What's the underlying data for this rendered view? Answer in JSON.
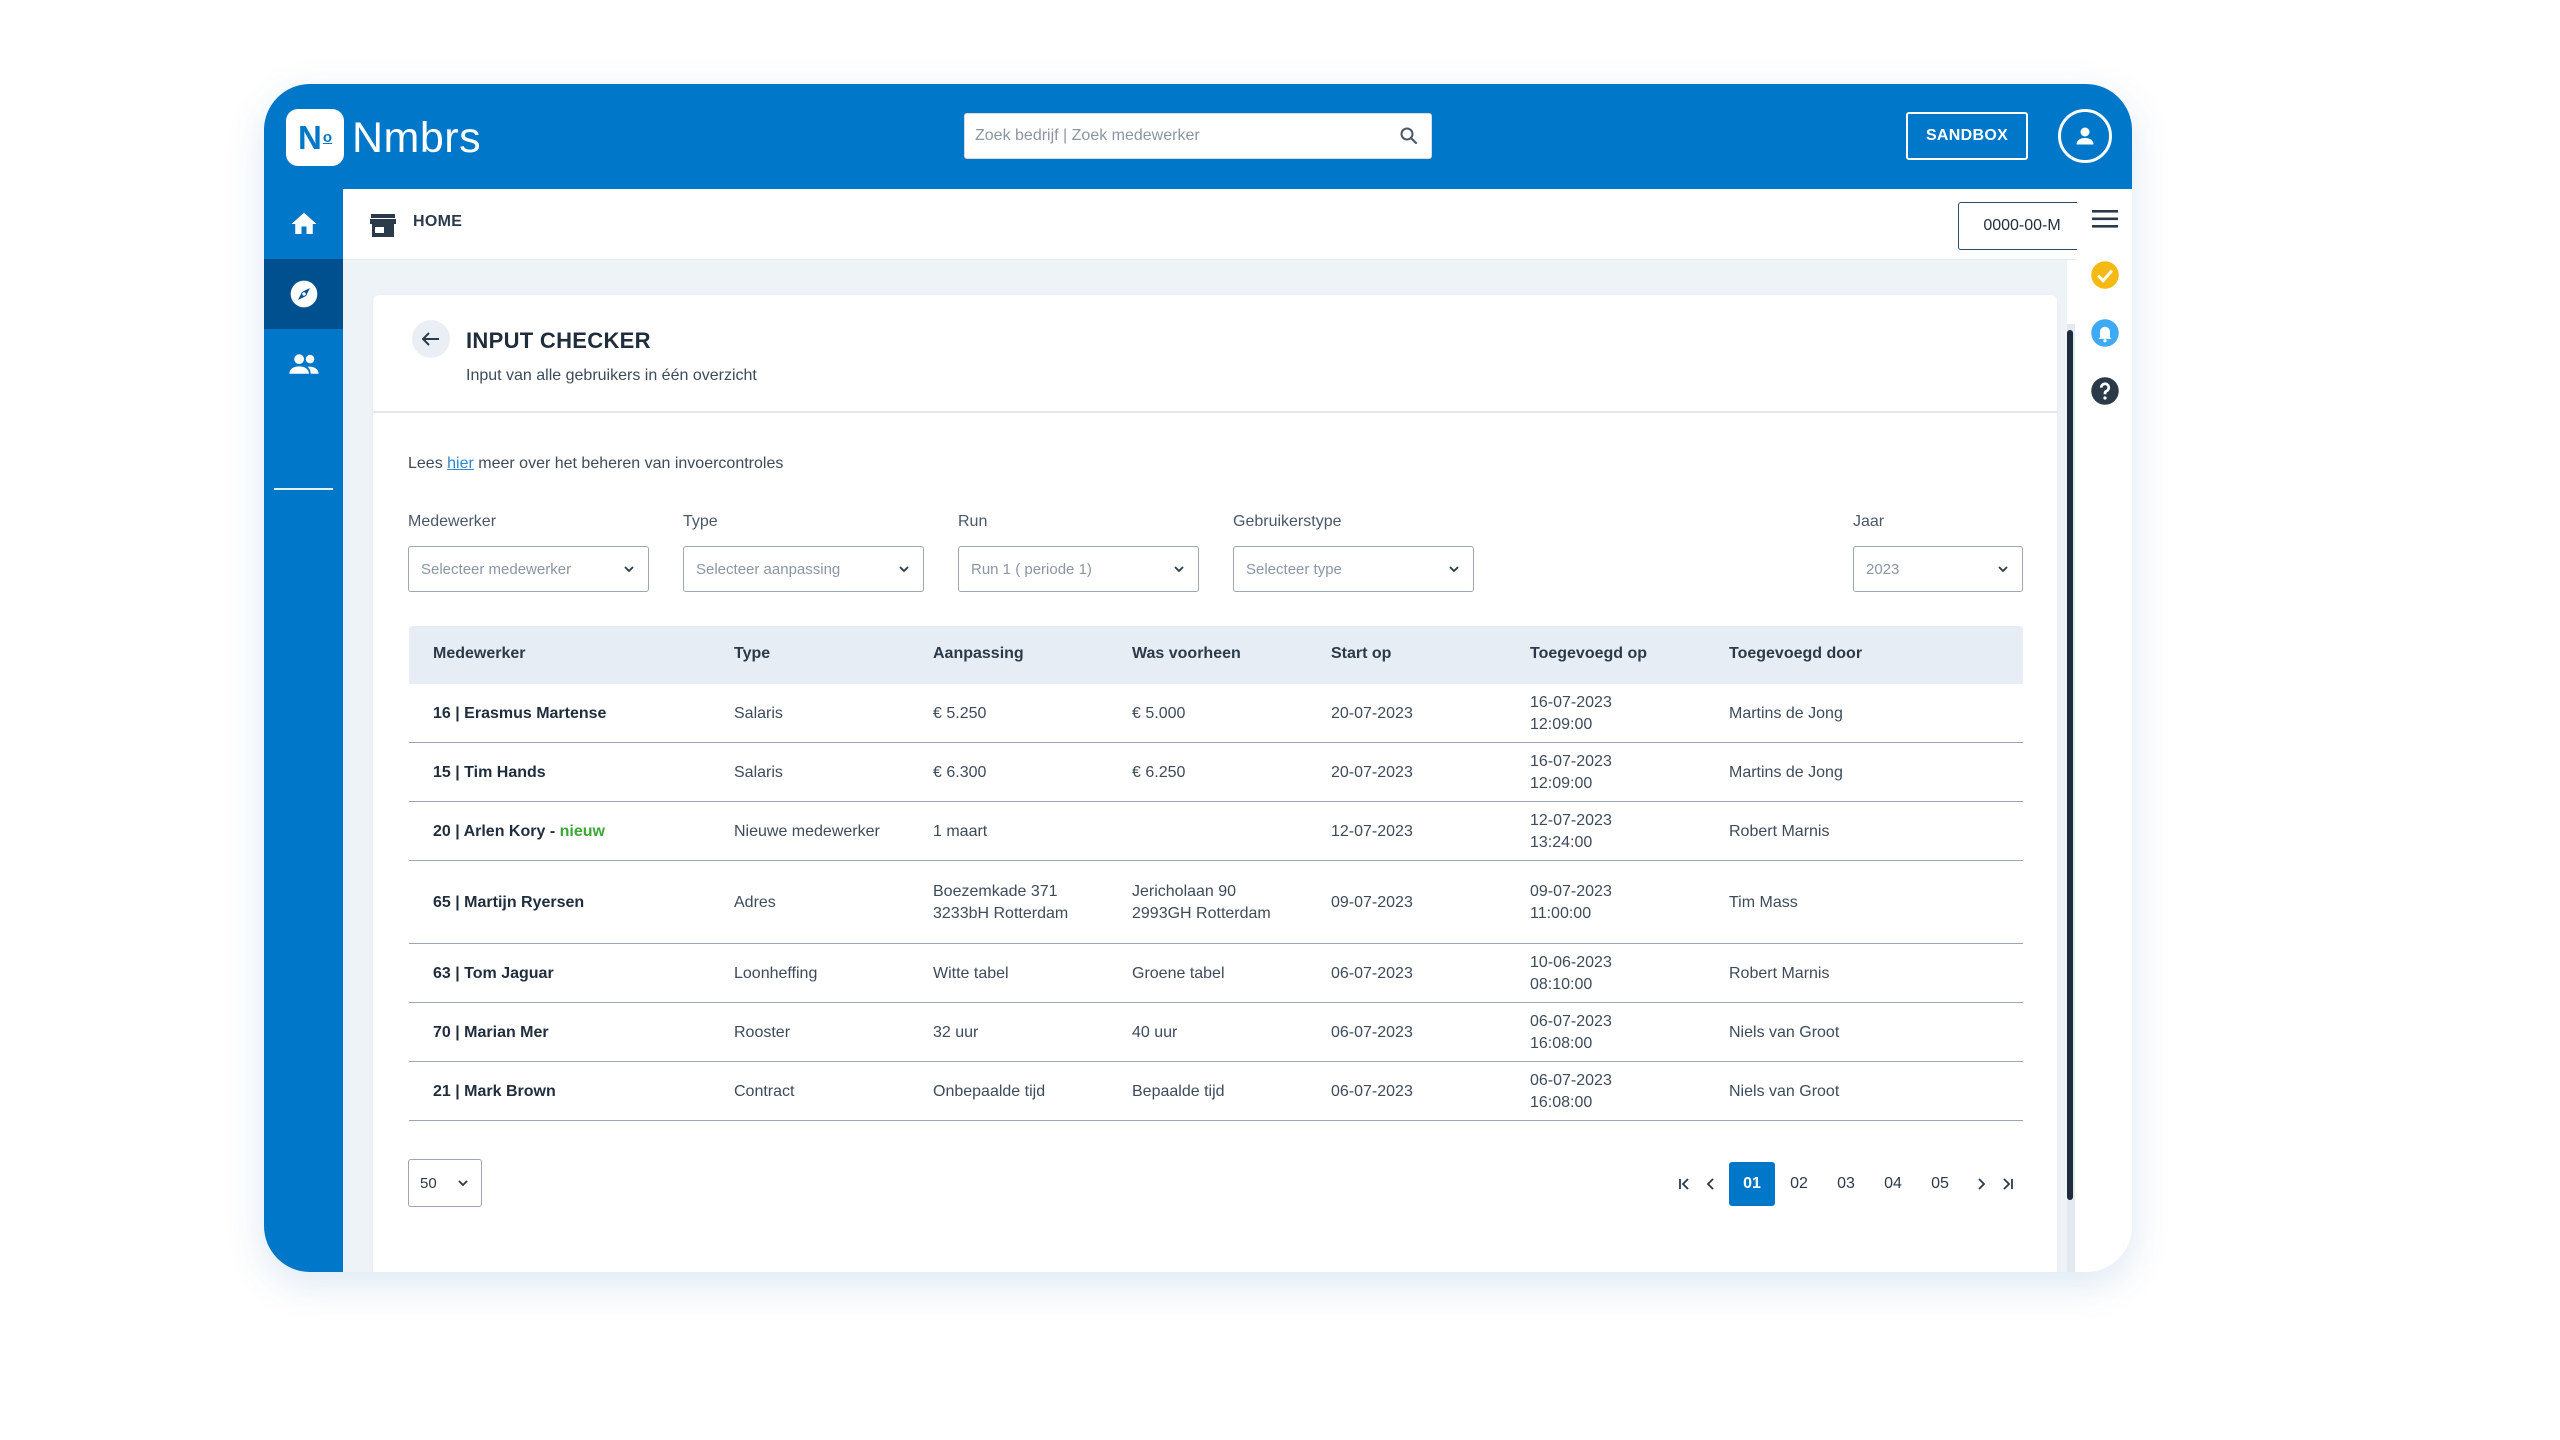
{
  "app": {
    "logo_mark": "N",
    "logo_sup": "o",
    "name": "Nmbrs"
  },
  "search": {
    "placeholder": "Zoek bedrijf | Zoek medewerker",
    "value": ""
  },
  "header": {
    "environment_label": "SANDBOX"
  },
  "breadcrumb": {
    "label": "HOME"
  },
  "period": {
    "label": "0000-00-M"
  },
  "page": {
    "title": "INPUT CHECKER",
    "subtitle": "Input van alle gebruikers in één overzicht",
    "info_prefix": "Lees ",
    "info_link": "hier",
    "info_suffix": " meer over het beheren van invoercontroles"
  },
  "filters": {
    "employee": {
      "label": "Medewerker",
      "value": "Selecteer medewerker"
    },
    "type": {
      "label": "Type",
      "value": "Selecteer aanpassing"
    },
    "run": {
      "label": "Run",
      "value": "Run 1 ( periode 1)"
    },
    "usertype": {
      "label": "Gebruikerstype",
      "value": "Selecteer type"
    },
    "year": {
      "label": "Jaar",
      "value": "2023"
    }
  },
  "table": {
    "columns": [
      "Medewerker",
      "Type",
      "Aanpassing",
      "Was voorheen",
      "Start op",
      "Toegevoegd op",
      "Toegevoegd door"
    ],
    "rows": [
      {
        "employee": "16 | Erasmus Martense",
        "tag": "",
        "type": "Salaris",
        "change": [
          "€ 5.250"
        ],
        "previous": [
          "€ 5.000"
        ],
        "start": "20-07-2023",
        "added_on": [
          "16-07-2023",
          "12:09:00"
        ],
        "added_by": "Martins de Jong"
      },
      {
        "employee": "15 | Tim Hands",
        "tag": "",
        "type": "Salaris",
        "change": [
          "€ 6.300"
        ],
        "previous": [
          "€ 6.250"
        ],
        "start": "20-07-2023",
        "added_on": [
          "16-07-2023",
          "12:09:00"
        ],
        "added_by": "Martins de Jong"
      },
      {
        "employee": "20 | Arlen Kory - ",
        "tag": "nieuw",
        "type": "Nieuwe medewerker",
        "change": [
          "1 maart"
        ],
        "previous": [],
        "start": "12-07-2023",
        "added_on": [
          "12-07-2023",
          "13:24:00"
        ],
        "added_by": "Robert Marnis"
      },
      {
        "employee": "65 | Martijn Ryersen",
        "tag": "",
        "type": "Adres",
        "change": [
          "Boezemkade 371",
          "3233bH Rotterdam"
        ],
        "previous": [
          "Jericholaan 90",
          "2993GH Rotterdam"
        ],
        "start": "09-07-2023",
        "added_on": [
          "09-07-2023",
          "11:00:00"
        ],
        "added_by": "Tim Mass"
      },
      {
        "employee": "63 | Tom Jaguar",
        "tag": "",
        "type": "Loonheffing",
        "change": [
          "Witte tabel"
        ],
        "previous": [
          "Groene tabel"
        ],
        "start": "06-07-2023",
        "added_on": [
          "10-06-2023",
          "08:10:00"
        ],
        "added_by": "Robert Marnis"
      },
      {
        "employee": "70 | Marian Mer",
        "tag": "",
        "type": "Rooster",
        "change": [
          "32 uur"
        ],
        "previous": [
          "40 uur"
        ],
        "start": "06-07-2023",
        "added_on": [
          "06-07-2023",
          "16:08:00"
        ],
        "added_by": "Niels van Groot"
      },
      {
        "employee": "21 | Mark Brown",
        "tag": "",
        "type": "Contract",
        "change": [
          "Onbepaalde tijd"
        ],
        "previous": [
          "Bepaalde tijd"
        ],
        "start": "06-07-2023",
        "added_on": [
          "06-07-2023",
          "16:08:00"
        ],
        "added_by": "Niels van Groot"
      }
    ]
  },
  "pagination": {
    "page_size": "50",
    "pages": [
      "01",
      "02",
      "03",
      "04",
      "05"
    ],
    "current": "01"
  },
  "icons": {
    "nav": [
      "home-icon",
      "compass-icon",
      "people-icon"
    ],
    "rail": [
      "menu-icon",
      "check-circle-icon",
      "bell-icon",
      "help-icon"
    ]
  },
  "colors": {
    "brand": "#0077c8",
    "brand_dark": "#00508f",
    "new_tag": "#3aa835",
    "check": "#f5b914",
    "bell": "#3ea9f5",
    "help": "#2b3a4a"
  }
}
